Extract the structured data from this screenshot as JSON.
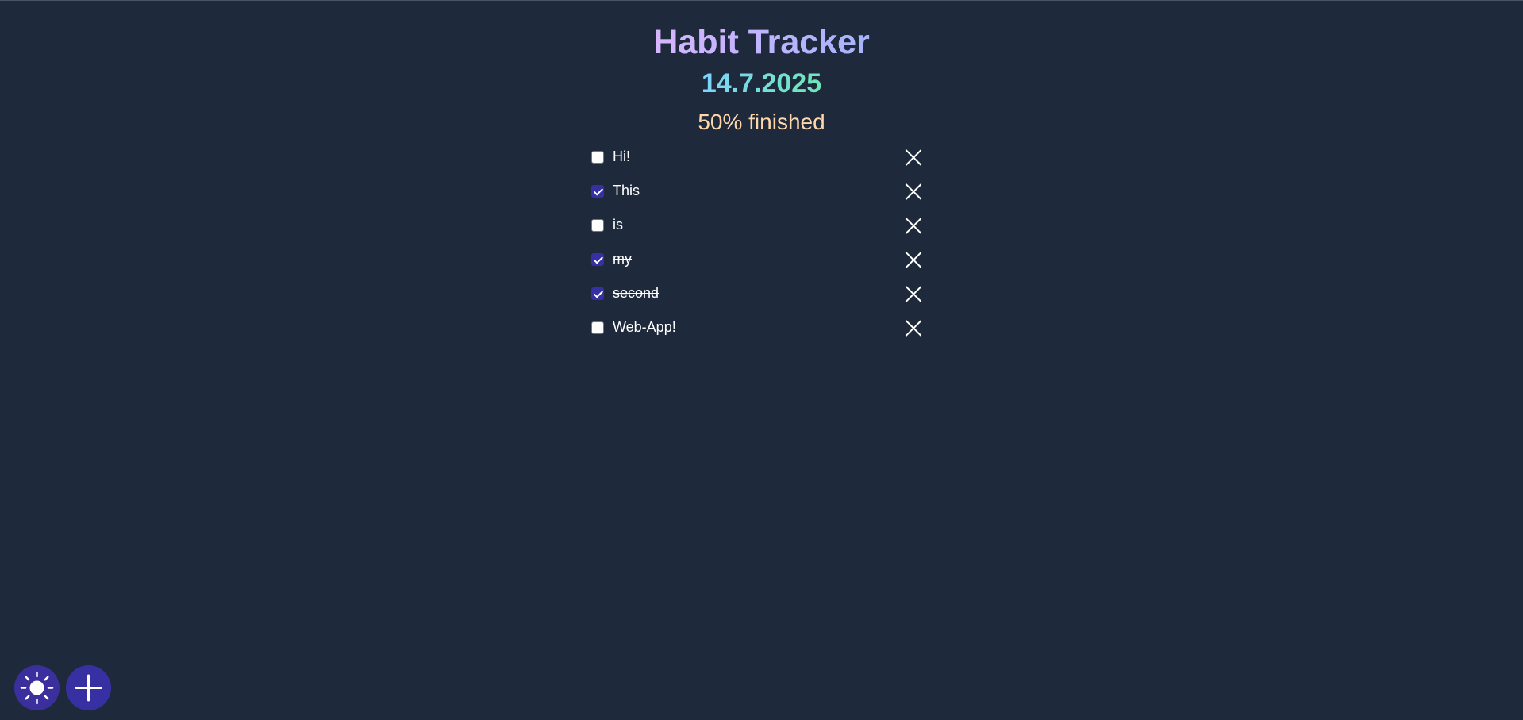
{
  "app": {
    "title": "Habit Tracker",
    "date": "14.7.2025",
    "progress_text": "50% finished",
    "progress_percent": 50
  },
  "habits": [
    {
      "label": "Hi!",
      "checked": false
    },
    {
      "label": "This",
      "checked": true
    },
    {
      "label": "is",
      "checked": false
    },
    {
      "label": "my",
      "checked": true
    },
    {
      "label": "second",
      "checked": true
    },
    {
      "label": "Web-App!",
      "checked": false
    }
  ],
  "icons": {
    "delete": "close-icon",
    "theme_toggle": "sun-icon",
    "add_habit": "plus-icon"
  },
  "colors": {
    "background": "#1e293b",
    "accent": "#3730a3",
    "progress_text": "#fed7aa"
  }
}
